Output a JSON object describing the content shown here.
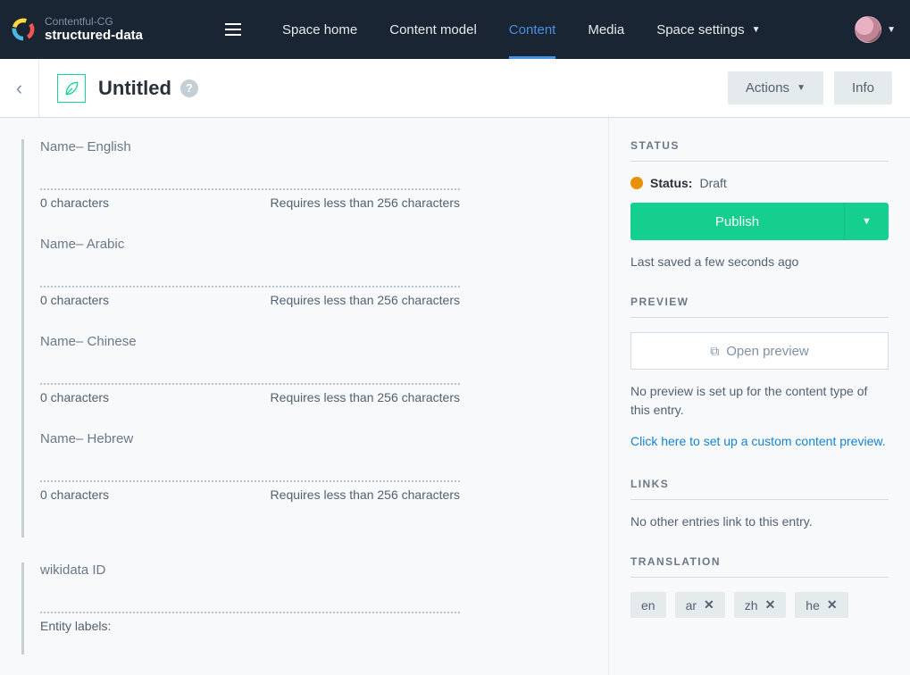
{
  "header": {
    "org": "Contentful-CG",
    "space": "structured-data",
    "nav": {
      "space_home": "Space home",
      "content_model": "Content model",
      "content": "Content",
      "media": "Media",
      "space_settings": "Space settings"
    }
  },
  "titlebar": {
    "title": "Untitled",
    "actions_label": "Actions",
    "info_label": "Info"
  },
  "fields": {
    "group1": [
      {
        "label": "Name– English",
        "chars": "0 characters",
        "hint": "Requires less than 256 characters"
      },
      {
        "label": "Name– Arabic",
        "chars": "0 characters",
        "hint": "Requires less than 256 characters"
      },
      {
        "label": "Name– Chinese",
        "chars": "0 characters",
        "hint": "Requires less than 256 characters"
      },
      {
        "label": "Name– Hebrew",
        "chars": "0 characters",
        "hint": "Requires less than 256 characters"
      }
    ],
    "group2": {
      "label": "wikidata ID",
      "static_label": "Entity labels:"
    }
  },
  "sidebar": {
    "status": {
      "heading": "STATUS",
      "label": "Status:",
      "value": "Draft",
      "publish": "Publish",
      "saved": "Last saved a few seconds ago"
    },
    "preview": {
      "heading": "PREVIEW",
      "button": "Open preview",
      "text": "No preview is set up for the content type of this entry.",
      "link": "Click here to set up a custom content preview."
    },
    "links": {
      "heading": "LINKS",
      "text": "No other entries link to this entry."
    },
    "translation": {
      "heading": "TRANSLATION",
      "chips": [
        "en",
        "ar",
        "zh",
        "he"
      ]
    }
  }
}
